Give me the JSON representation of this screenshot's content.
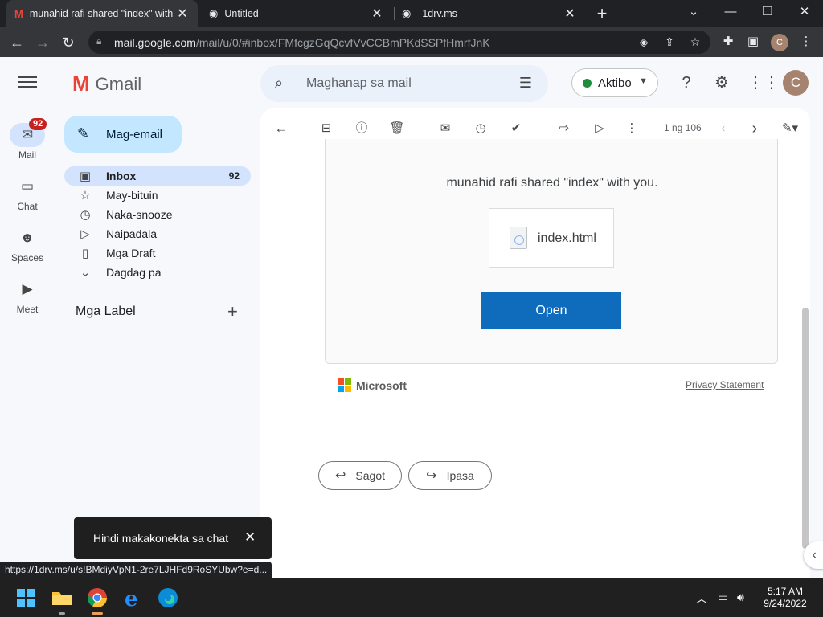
{
  "browser": {
    "tabs": [
      {
        "title": "munahid rafi shared \"index\" with",
        "close": "✕",
        "favicon": "gmail-icon"
      },
      {
        "title": "Untitled",
        "close": "✕",
        "favicon": "globe-icon"
      },
      {
        "title": "1drv.ms",
        "close": "✕",
        "favicon": "globe-icon"
      }
    ],
    "new_tab": "+",
    "window_controls": {
      "dropdown": "⌄",
      "minimize": "—",
      "restore": "❐",
      "close": "✕"
    },
    "url_host": "mail.google.com",
    "url_path": "/mail/u/0/#inbox/FMfcgzGqQcvfVvCCBmPKdSSPfHmrfJnK",
    "profile_initial": "C"
  },
  "gmail": {
    "logo_text": "Gmail",
    "search_placeholder": "Maghanap sa mail",
    "status": "Aktibo",
    "avatar_initial": "C",
    "rail": [
      {
        "label": "Mail",
        "badge": "92"
      },
      {
        "label": "Chat"
      },
      {
        "label": "Spaces"
      },
      {
        "label": "Meet"
      }
    ],
    "compose_label": "Mag-email",
    "nav": [
      {
        "label": "Inbox",
        "count": "92"
      },
      {
        "label": "May-bituin",
        "count": ""
      },
      {
        "label": "Naka-snooze",
        "count": ""
      },
      {
        "label": "Naipadala",
        "count": ""
      },
      {
        "label": "Mga Draft",
        "count": ""
      },
      {
        "label": "Dagdag pa",
        "count": ""
      }
    ],
    "labels_header": "Mga Label",
    "labels_add": "+",
    "pager": "1 ng 106"
  },
  "email": {
    "shared_text": "munahid rafi shared \"index\" with you.",
    "file_name": "index.html",
    "open_label": "Open",
    "ms_name": "Microsoft",
    "privacy_label": "Privacy Statement",
    "reply_label": "Sagot",
    "forward_label": "Ipasa"
  },
  "snackbar": {
    "text": "Hindi makakonekta sa chat",
    "close": "✕"
  },
  "status_url": "https://1drv.ms/u/s!BMdiyVpN1-2re7LJHFd9RoSYUbw?e=d...",
  "taskbar": {
    "time": "5:17 AM",
    "date": "9/24/2022"
  },
  "colors": {
    "accent": "#0f6cbd",
    "compose": "#c2e7ff",
    "active_nav": "#d3e3fd",
    "badge": "#c5221f",
    "status_green": "#1e8e3e"
  }
}
